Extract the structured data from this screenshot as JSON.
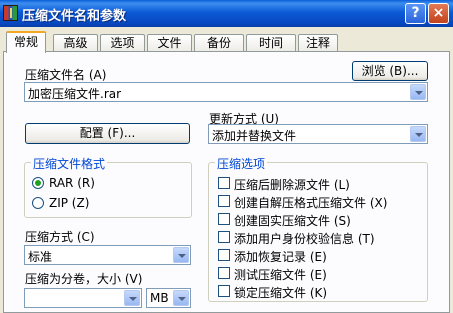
{
  "window": {
    "title": "压缩文件名和参数",
    "help_glyph": "?",
    "close_glyph": "×"
  },
  "tabs": [
    {
      "label": "常规"
    },
    {
      "label": "高级"
    },
    {
      "label": "选项"
    },
    {
      "label": "文件"
    },
    {
      "label": "备份"
    },
    {
      "label": "时间"
    },
    {
      "label": "注释"
    }
  ],
  "general": {
    "archive_name_label": "压缩文件名 (A)",
    "browse_button": "浏览 (B)...",
    "archive_name_value": "加密压缩文件.rar",
    "update_mode_label": "更新方式 (U)",
    "update_mode_value": "添加并替换文件",
    "profiles_button": "配置 (F)...",
    "format_group": {
      "title": "压缩文件格式",
      "options": [
        {
          "label": "RAR (R)",
          "checked": true
        },
        {
          "label": "ZIP (Z)",
          "checked": false
        }
      ]
    },
    "options_group": {
      "title": "压缩选项",
      "items": [
        {
          "label": "压缩后删除源文件 (L)",
          "checked": false
        },
        {
          "label": "创建自解压格式压缩文件 (X)",
          "checked": false
        },
        {
          "label": "创建固实压缩文件 (S)",
          "checked": false
        },
        {
          "label": "添加用户身份校验信息 (T)",
          "checked": false
        },
        {
          "label": "添加恢复记录 (E)",
          "checked": false
        },
        {
          "label": "测试压缩文件 (E)",
          "checked": false
        },
        {
          "label": "锁定压缩文件 (K)",
          "checked": false
        }
      ]
    },
    "method_label": "压缩方式 (C)",
    "method_value": "标准",
    "split_label": "压缩为分卷，大小 (V)",
    "split_value": "",
    "split_unit": "MB"
  }
}
